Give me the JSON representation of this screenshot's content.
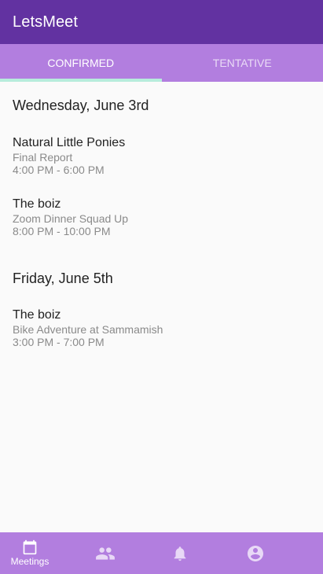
{
  "app": {
    "title": "LetsMeet"
  },
  "tabs": [
    {
      "label": "CONFIRMED",
      "active": true
    },
    {
      "label": "TENTATIVE",
      "active": false
    }
  ],
  "days": [
    {
      "header": "Wednesday, June 3rd",
      "meetings": [
        {
          "group": "Natural Little Ponies",
          "title": "Final Report",
          "time": "4:00 PM - 6:00 PM"
        },
        {
          "group": "The boiz",
          "title": "Zoom Dinner Squad Up",
          "time": "8:00 PM - 10:00 PM"
        }
      ]
    },
    {
      "header": "Friday, June 5th",
      "meetings": [
        {
          "group": "The boiz",
          "title": "Bike Adventure at Sammamish",
          "time": "3:00 PM - 7:00 PM"
        }
      ]
    }
  ],
  "bottom_nav": {
    "items": [
      {
        "icon": "calendar-icon",
        "label": "Meetings",
        "active": true
      },
      {
        "icon": "people-icon",
        "active": false
      },
      {
        "icon": "bell-icon",
        "active": false
      },
      {
        "icon": "account-circle-icon",
        "active": false
      }
    ]
  },
  "colors": {
    "app_bar": "#6232a1",
    "tab_bar": "#b27edf",
    "tab_indicator": "#b7ecdc",
    "background": "#fafafa",
    "bottom_nav": "#b27edf"
  }
}
